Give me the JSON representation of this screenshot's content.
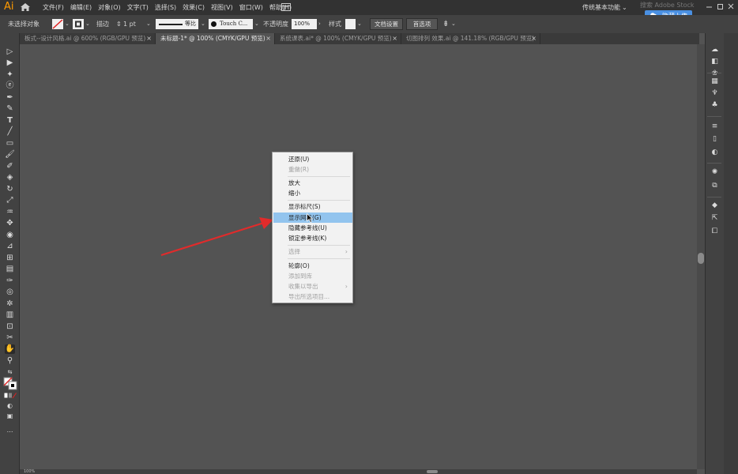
{
  "app": {
    "logo": "Ai"
  },
  "menubar": {
    "items": [
      "文件(F)",
      "编辑(E)",
      "对象(O)",
      "文字(T)",
      "选择(S)",
      "效果(C)",
      "视图(V)",
      "窗口(W)",
      "帮助(H)"
    ],
    "workspace": "传统基本功能",
    "search_placeholder": "搜索 Adobe Stock",
    "upload_label": "隐藏上传"
  },
  "controlbar": {
    "selection_label": "未选择对象",
    "stroke_label": "描边",
    "stroke_value": "1 pt",
    "stroke_profile": "等比",
    "brush_label": "Touch C...",
    "opacity_label": "不透明度",
    "opacity_value": "100%",
    "style_label": "样式",
    "doc_setup": "文档设置",
    "preferences": "首选项"
  },
  "tabs": [
    {
      "label": "板式--设计风格.ai @ 600% (RGB/GPU 预览)",
      "active": false
    },
    {
      "label": "未标题-1* @ 100% (CMYK/GPU 预览)",
      "active": true
    },
    {
      "label": "系统课表.ai* @ 100% (CMYK/GPU 预览)",
      "active": false
    },
    {
      "label": "切图排列 效果.ai @ 141.18% (RGB/GPU 预览)",
      "active": false
    }
  ],
  "context_menu": {
    "items": [
      {
        "label": "还原(U)",
        "enabled": true
      },
      {
        "label": "重做(R)",
        "enabled": false
      },
      {
        "label": "放大",
        "enabled": true
      },
      {
        "label": "缩小",
        "enabled": true
      },
      {
        "label": "显示标尺(S)",
        "enabled": true
      },
      {
        "label": "显示网格(G)",
        "enabled": true,
        "hover": true
      },
      {
        "label": "隐藏参考线(U)",
        "enabled": true
      },
      {
        "label": "锁定参考线(K)",
        "enabled": true
      },
      {
        "label": "选择",
        "enabled": false,
        "submenu": true
      },
      {
        "label": "轮廓(O)",
        "enabled": true
      },
      {
        "label": "添加到库",
        "enabled": false
      },
      {
        "label": "收集以导出",
        "enabled": false,
        "submenu": true
      },
      {
        "label": "导出所选项目...",
        "enabled": false
      }
    ]
  },
  "status": {
    "zoom": "100%"
  },
  "colors": {
    "accent": "#ff9a00",
    "hover": "#92c4ee",
    "upload": "#4a90e2",
    "arrow": "#e02b2b"
  },
  "icons": {
    "toolbar": [
      "selection-tool-icon",
      "direct-selection-tool-icon",
      "magic-wand-icon",
      "lasso-icon",
      "pen-tool-icon",
      "curvature-icon",
      "type-tool-icon",
      "line-tool-icon",
      "rectangle-tool-icon",
      "paintbrush-icon",
      "blob-brush-icon",
      "eraser-icon",
      "rotate-tool-icon",
      "scale-tool-icon",
      "warp-tool-icon",
      "free-transform-icon",
      "shape-builder-icon",
      "perspective-icon",
      "mesh-icon",
      "gradient-icon",
      "eyedropper-icon",
      "blend-icon",
      "symbol-sprayer-icon",
      "graph-icon",
      "artboard-icon",
      "slice-icon",
      "hand-tool-icon",
      "zoom-tool-icon"
    ],
    "right_dock": [
      "color-icon",
      "color-guide-icon",
      "swatches-icon",
      "brushes-icon",
      "symbols-icon",
      "stroke-icon",
      "gradient-panel-icon",
      "transparency-icon",
      "appearance-icon",
      "graphic-styles-icon",
      "layers-icon",
      "asset-export-icon",
      "artboards-panel-icon"
    ]
  }
}
